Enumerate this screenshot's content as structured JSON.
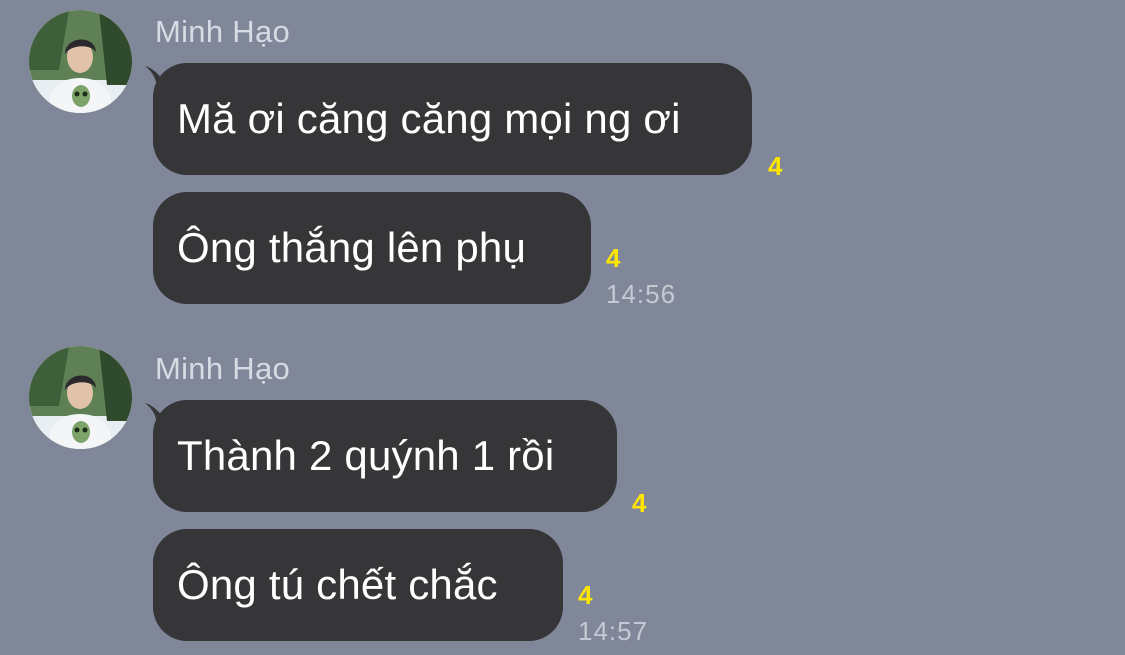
{
  "colors": {
    "background": "#7f8799",
    "bubble": "#363638",
    "bubble_text": "#ffffff",
    "read_count": "#ffe600",
    "meta_text": "#c4c9d3"
  },
  "groups": [
    {
      "sender": "Minh Hạo",
      "avatar_icon": "user-avatar",
      "messages": [
        {
          "text": "Mă ơi căng căng mọi ng ơi",
          "read_count": "4",
          "time": ""
        },
        {
          "text": "Ông thắng lên phụ",
          "read_count": "4",
          "time": "14:56"
        }
      ]
    },
    {
      "sender": "Minh Hạo",
      "avatar_icon": "user-avatar",
      "messages": [
        {
          "text": "Thành 2 quýnh 1 rồi",
          "read_count": "4",
          "time": ""
        },
        {
          "text": "Ông tú chết chắc",
          "read_count": "4",
          "time": "14:57"
        }
      ]
    }
  ]
}
